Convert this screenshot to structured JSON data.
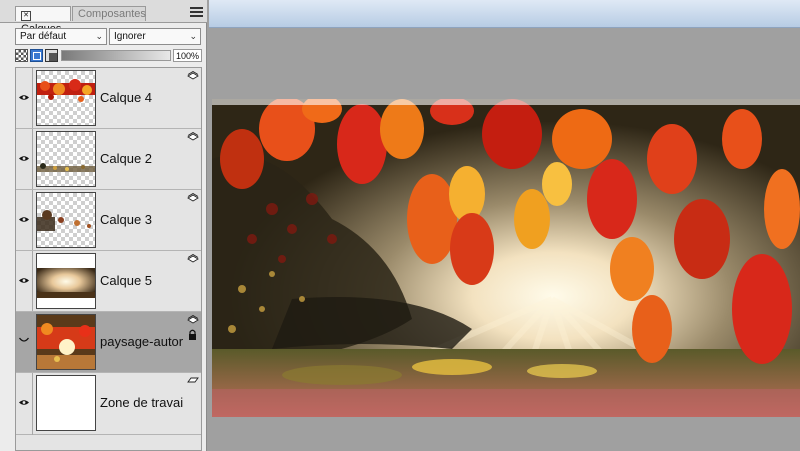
{
  "panel": {
    "tabs": [
      {
        "label": "Calques",
        "active": true
      },
      {
        "label": "Composantes",
        "active": false
      }
    ],
    "menu_icon": "hamburger-menu-icon",
    "blend_mode": "Par défaut",
    "composite_option": "Ignorer",
    "opacity": "100%",
    "opacity_value": 1.0
  },
  "layers": [
    {
      "name": "Calque 4",
      "visible": true,
      "selected": false,
      "locked": false
    },
    {
      "name": "Calque 2",
      "visible": true,
      "selected": false,
      "locked": false
    },
    {
      "name": "Calque 3",
      "visible": true,
      "selected": false,
      "locked": false
    },
    {
      "name": "Calque 5",
      "visible": true,
      "selected": false,
      "locked": false
    },
    {
      "name": "paysage-autor",
      "visible": false,
      "selected": true,
      "locked": true
    },
    {
      "name": "Zone de travai",
      "visible": true,
      "selected": false,
      "locked": false
    }
  ],
  "colors": {
    "selected_row": "#a6a6a6",
    "accent_blue": "#3a78d0",
    "leaf_red": "#d8281a",
    "leaf_orange": "#ee7a18",
    "sun_glow": "#fff6d8"
  }
}
